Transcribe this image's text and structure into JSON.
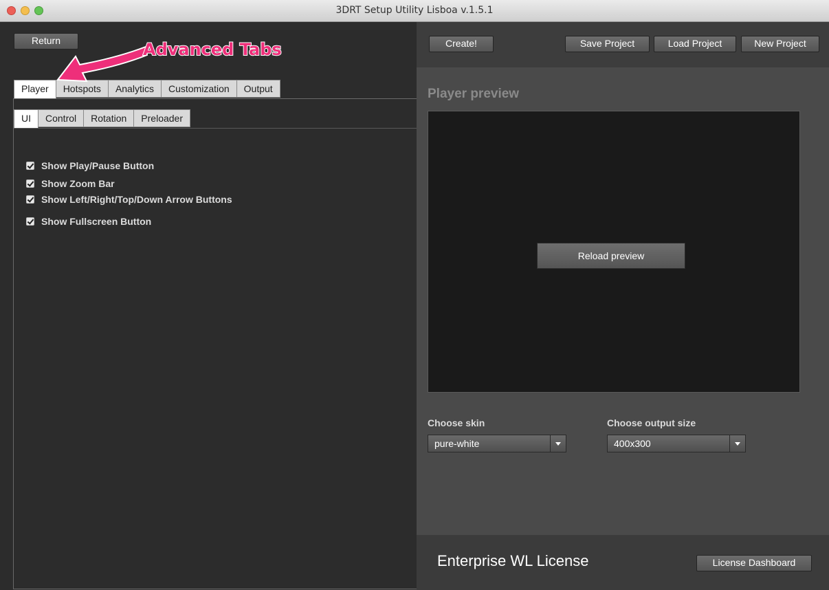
{
  "window": {
    "title": "3DRT Setup Utility Lisboa v.1.5.1"
  },
  "left": {
    "return_label": "Return",
    "annotation": "Advanced Tabs",
    "main_tabs": [
      "Player",
      "Hotspots",
      "Analytics",
      "Customization",
      "Output"
    ],
    "active_main_tab": "Player",
    "sub_tabs": [
      "UI",
      "Control",
      "Rotation",
      "Preloader"
    ],
    "active_sub_tab": "UI",
    "options": [
      {
        "label": "Show Play/Pause Button",
        "checked": true
      },
      {
        "label": "Show Zoom Bar",
        "checked": true
      },
      {
        "label": "Show Left/Right/Top/Down Arrow Buttons",
        "checked": true
      },
      {
        "label": "Show Fullscreen Button",
        "checked": true
      }
    ]
  },
  "toolbar": {
    "create_label": "Create!",
    "save_label": "Save Project",
    "load_label": "Load Project",
    "new_label": "New Project"
  },
  "preview": {
    "title": "Player preview",
    "reload_label": "Reload preview",
    "skin_label": "Choose skin",
    "skin_value": "pure-white",
    "size_label": "Choose output size",
    "size_value": "400x300"
  },
  "license": {
    "text": "Enterprise WL License",
    "dashboard_label": "License Dashboard"
  },
  "colors": {
    "annotation": "#ee2f7a"
  }
}
